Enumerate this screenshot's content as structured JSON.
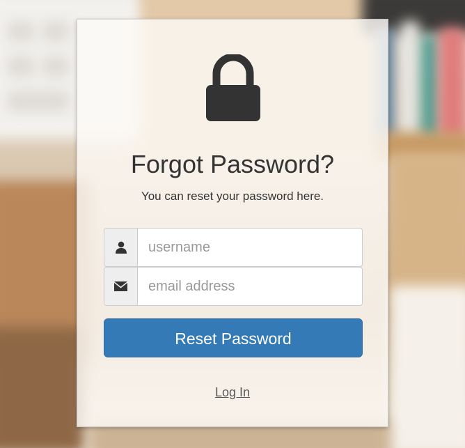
{
  "colors": {
    "primary_button": "#337ab7",
    "card_background": "#fcfaf6",
    "icon_dark": "#333333",
    "addon_background": "#eeeeee"
  },
  "card": {
    "icon": "lock-icon",
    "title": "Forgot Password?",
    "subtitle": "You can reset your password here."
  },
  "form": {
    "username": {
      "icon": "user-icon",
      "value": "",
      "placeholder": "username"
    },
    "email": {
      "icon": "envelope-icon",
      "value": "",
      "placeholder": "email address"
    },
    "submit_label": "Reset Password"
  },
  "footer": {
    "login_link": "Log In"
  }
}
